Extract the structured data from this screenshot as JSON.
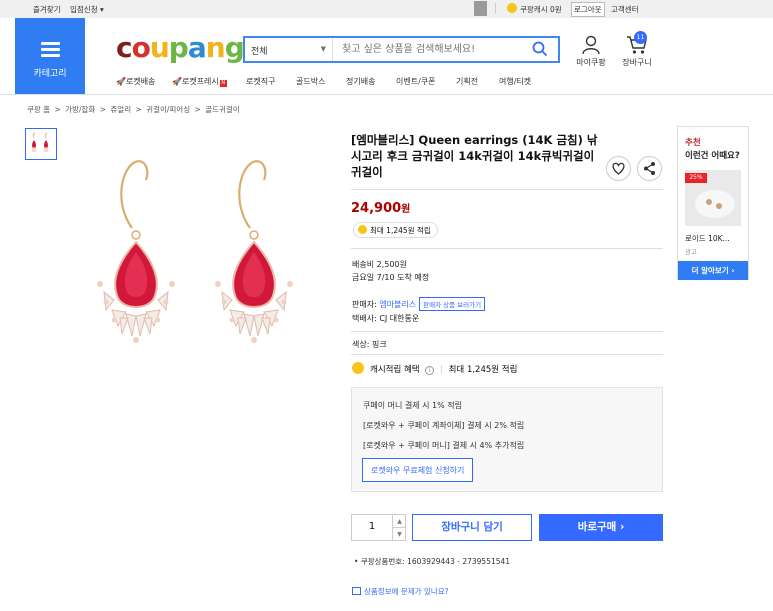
{
  "topbar": {
    "bookmark": "즐겨찾기",
    "seller_signup": "입점신청",
    "cash": "쿠팡캐시 0원",
    "logout": "로그아웃",
    "cs": "고객센터"
  },
  "header": {
    "category_label": "카테고리",
    "search_category": "전체",
    "search_placeholder": "찾고 싶은 상품을 검색해보세요!",
    "mypage_label": "마이쿠팡",
    "cart_label": "장바구니",
    "cart_count": "11",
    "subnav": [
      "로켓배송",
      "로켓프레시",
      "로켓직구",
      "골드박스",
      "정기배송",
      "이벤트/쿠폰",
      "기획전",
      "여행/티켓"
    ]
  },
  "breadcrumb": [
    "쿠팡 홈",
    ">",
    "가방/잡화",
    ">",
    "쥬얼리",
    ">",
    "귀걸이/피어싱",
    ">",
    "골드귀걸이"
  ],
  "product": {
    "title": "[엠마블리스] Queen earrings (14K 금침) 낚시고리 후크 금귀걸이 14k귀걸이 14k큐빅귀걸이 귀걸이",
    "price": "24,900",
    "price_unit": "원",
    "max_points": "최대 1,245원 적립",
    "shipping_fee": "배송비 2,500원",
    "arrival": "금요일 7/10 도착 예정",
    "seller_label": "판매자: ",
    "seller_name": "엠마블리스",
    "seller_more": "판매자 상품 보러가기",
    "courier": "택배사: CJ 대한통운",
    "color": "색상: 핑크",
    "cash_benefit": "캐시적립 혜택",
    "cash_max": "최대 1,245원 적립",
    "pay_lines": [
      "쿠페이 머니 결제 시 1% 적립",
      "[로켓와우 + 쿠페이 계좌이체] 결제 시 2% 적립",
      "[로켓와우 + 쿠페이 머니] 결제 시 4% 추가적립"
    ],
    "trial_button": "로켓와우 무료체험 신청하기",
    "quantity": "1",
    "cart_button": "장바구니 담기",
    "buy_button": "바로구매",
    "product_code": "쿠팡상품번호: 1603929443 - 2739551541",
    "report": "상품정보에 문제가 있나요?"
  },
  "recommend": {
    "heading": "추천",
    "subheading": "이런건 어때요?",
    "discount": "25%",
    "item_name": "로이드 10K...",
    "ad": "광고",
    "more_button": "더 알아보기"
  },
  "colors": {
    "accent": "#346aff",
    "price": "#ae0000",
    "category_bg": "#2f7cf3"
  }
}
